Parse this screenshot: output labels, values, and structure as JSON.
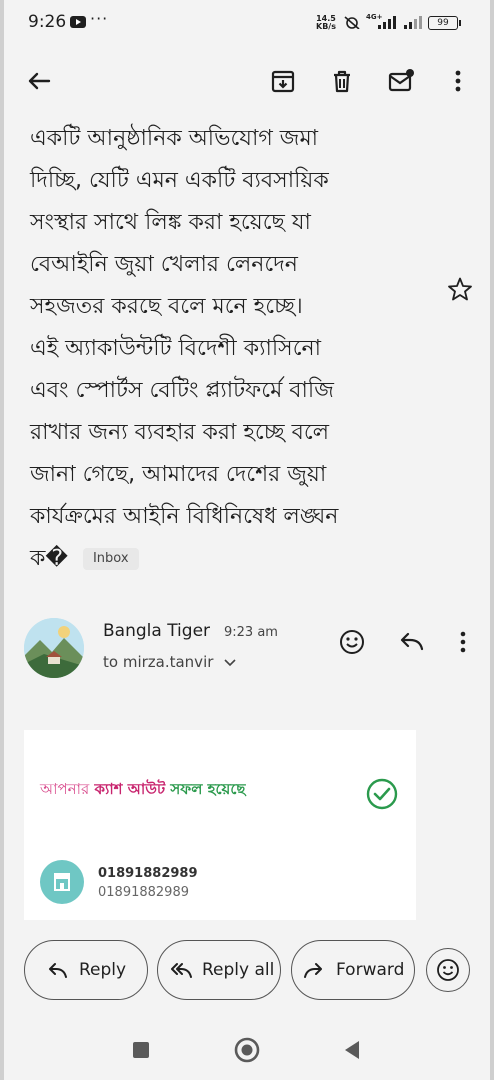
{
  "status_bar": {
    "time": "9:26",
    "more": "···",
    "speed_value": "14.5",
    "speed_unit": "KB/s",
    "network": "4G+",
    "battery": "99"
  },
  "toolbar": {
    "back_icon": "arrow-left-icon",
    "archive_icon": "archive-icon",
    "delete_icon": "trash-icon",
    "mark_unread_icon": "mail-unread-icon",
    "more_icon": "more-vert-icon"
  },
  "email": {
    "body_lines": [
      "একটি আনুষ্ঠানিক অভিযোগ জমা",
      "দিচ্ছি, যেটি এমন একটি ব্যবসায়িক",
      "সংস্থার সাথে লিঙ্ক করা হয়েছে যা",
      "বেআইনি জুয়া খেলার লেনদেন",
      "সহজতর করছে বলে মনে হচ্ছে।",
      "এই অ্যাকাউন্টটি বিদেশী ক্যাসিনো",
      "এবং স্পোর্টস বেটিং প্ল্যাটফর্মে বাজি",
      "রাখার জন্য ব্যবহার করা হচ্ছে বলে",
      "জানা গেছে, আমাদের দেশের জুয়া",
      "কার্যক্রমের আইনি বিধিনিষেধ লঙ্ঘন"
    ],
    "last_line": "ক�",
    "label": "Inbox"
  },
  "sender": {
    "name": "Bangla Tiger",
    "time": "9:23 am",
    "to": "to mirza.tanvir"
  },
  "card": {
    "part1": "আপনার",
    "part2": "ক্যাশ আউট",
    "part3": "সফল হয়েছে",
    "number_primary": "01891882989",
    "number_secondary": "01891882989"
  },
  "actions": {
    "reply": "Reply",
    "reply_all": "Reply all",
    "forward": "Forward"
  },
  "colors": {
    "accent_pink": "#d84a8c",
    "accent_magenta": "#c8246e",
    "success_green": "#2b9a4d"
  }
}
